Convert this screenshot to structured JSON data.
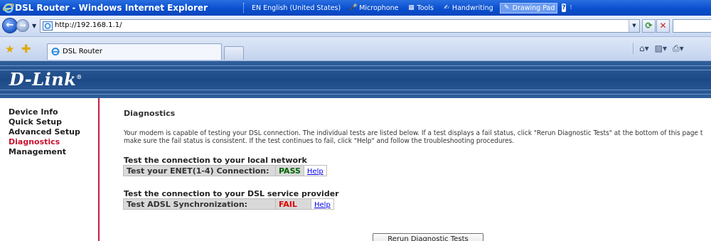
{
  "window": {
    "title": "DSL Router - Windows Internet Explorer"
  },
  "language_bar": {
    "language": "EN English (United States)",
    "microphone": "Microphone",
    "tools": "Tools",
    "handwriting": "Handwriting",
    "drawing_pad": "Drawing Pad",
    "help": "?"
  },
  "address_bar": {
    "url": "http://192.168.1.1/"
  },
  "tabs": [
    {
      "label": "DSL Router"
    }
  ],
  "banner": {
    "logo": "D-Link",
    "logo_mark": "®"
  },
  "sidebar": {
    "items": [
      {
        "label": "Device Info",
        "active": false
      },
      {
        "label": "Quick Setup",
        "active": false
      },
      {
        "label": "Advanced Setup",
        "active": false
      },
      {
        "label": "Diagnostics",
        "active": true
      },
      {
        "label": "Management",
        "active": false
      }
    ]
  },
  "main": {
    "heading": "Diagnostics",
    "description_line1": "Your modem is capable of testing your DSL connection. The individual tests are listed below. If a test displays a fail status, click \"Rerun Diagnostic Tests\" at the bottom of this page t",
    "description_line2": "make sure the fail status is consistent. If the test continues to fail, click \"Help\" and follow the troubleshooting procedures.",
    "sections": [
      {
        "title": "Test the connection to your local network",
        "test_label": "Test your ENET(1-4) Connection:",
        "result": "PASS",
        "help": "Help"
      },
      {
        "title": "Test the connection to your DSL service provider",
        "test_label": "Test ADSL Synchronization:",
        "result": "FAIL",
        "help": "Help"
      }
    ],
    "rerun_button": "Rerun Diagnostic Tests"
  },
  "colors": {
    "titlebar": "#0a4fcf",
    "banner": "#1d4a86",
    "nav_active": "#c8102e",
    "pass": "#006400",
    "fail": "#e00000"
  }
}
